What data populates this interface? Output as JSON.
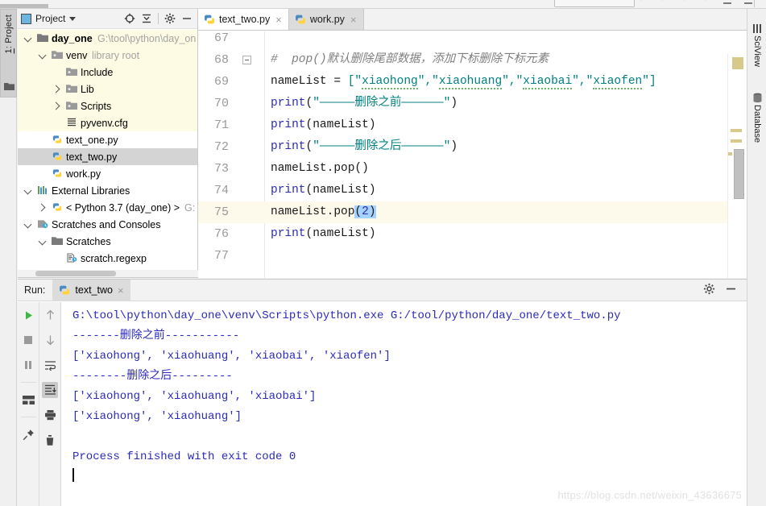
{
  "window": {
    "toolbar_hint": "partial-toolbar"
  },
  "left_rail": {
    "tab_label": "1: Project",
    "folder_icon": "folder-icon"
  },
  "project_panel": {
    "title": "Project",
    "icon": "project-window-icon",
    "caret": "chevron-down-icon",
    "buttons": [
      {
        "name": "locate-icon",
        "label": ""
      },
      {
        "name": "collapse-all-icon",
        "label": ""
      },
      {
        "name": "gear-icon",
        "label": ""
      },
      {
        "name": "hide-icon",
        "label": ""
      }
    ],
    "tree": [
      {
        "indent": 0,
        "arrow": "down",
        "icon": "folder-icon",
        "label": "day_one",
        "bold": true,
        "sub": "G:\\tool\\python\\day_on",
        "highlight": "yellow"
      },
      {
        "indent": 1,
        "arrow": "down",
        "icon": "module-icon",
        "label": "venv",
        "bold": false,
        "sub": "library root",
        "highlight": "yellow"
      },
      {
        "indent": 2,
        "arrow": "none",
        "icon": "module-icon",
        "label": "Include",
        "bold": false,
        "sub": "",
        "highlight": "yellow"
      },
      {
        "indent": 2,
        "arrow": "right",
        "icon": "module-icon",
        "label": "Lib",
        "bold": false,
        "sub": "",
        "highlight": "yellow"
      },
      {
        "indent": 2,
        "arrow": "right",
        "icon": "module-icon",
        "label": "Scripts",
        "bold": false,
        "sub": "",
        "highlight": "yellow"
      },
      {
        "indent": 2,
        "arrow": "none",
        "icon": "config-file-icon",
        "label": "pyvenv.cfg",
        "bold": false,
        "sub": "",
        "highlight": "yellow"
      },
      {
        "indent": 1,
        "arrow": "none",
        "icon": "python-file-icon",
        "label": "text_one.py",
        "bold": false,
        "sub": "",
        "highlight": "none"
      },
      {
        "indent": 1,
        "arrow": "none",
        "icon": "python-file-icon",
        "label": "text_two.py",
        "bold": false,
        "sub": "",
        "highlight": "gray"
      },
      {
        "indent": 1,
        "arrow": "none",
        "icon": "python-file-icon",
        "label": "work.py",
        "bold": false,
        "sub": "",
        "highlight": "none"
      },
      {
        "indent": 0,
        "arrow": "down",
        "icon": "libraries-icon",
        "label": "External Libraries",
        "bold": false,
        "sub": "",
        "highlight": "none"
      },
      {
        "indent": 1,
        "arrow": "right",
        "icon": "python-sdk-icon",
        "label": "< Python 3.7 (day_one) >",
        "bold": false,
        "sub": "G:",
        "highlight": "none"
      },
      {
        "indent": 0,
        "arrow": "down",
        "icon": "scratches-icon",
        "label": "Scratches and Consoles",
        "bold": false,
        "sub": "",
        "highlight": "none"
      },
      {
        "indent": 1,
        "arrow": "down",
        "icon": "folder-icon",
        "label": "Scratches",
        "bold": false,
        "sub": "",
        "highlight": "none"
      },
      {
        "indent": 2,
        "arrow": "none",
        "icon": "scratch-file-icon",
        "label": "scratch.regexp",
        "bold": false,
        "sub": "",
        "highlight": "none"
      }
    ]
  },
  "editor": {
    "tabs": [
      {
        "label": "text_two.py",
        "icon": "python-file-icon",
        "active": true,
        "close": "×"
      },
      {
        "label": "work.py",
        "icon": "python-file-icon",
        "active": false,
        "close": "×"
      }
    ],
    "first_line_number": 67,
    "current_line_number": 75,
    "lines": [
      {
        "num": 67,
        "text": "",
        "fold": false
      },
      {
        "num": 68,
        "text": "#  pop()默认删除尾部数据，添加下标删除下标元素",
        "fold": true
      },
      {
        "num": 69,
        "text": "nameList = [\"xiaohong\",\"xiaohuang\",\"xiaobai\",\"xiaofen\"]",
        "fold": false
      },
      {
        "num": 70,
        "text": "print(\"—————删除之前——————\")",
        "fold": false
      },
      {
        "num": 71,
        "text": "print(nameList)",
        "fold": false
      },
      {
        "num": 72,
        "text": "print(\"—————删除之后——————\")",
        "fold": false
      },
      {
        "num": 73,
        "text": "nameList.pop()",
        "fold": false
      },
      {
        "num": 74,
        "text": "print(nameList)",
        "fold": false
      },
      {
        "num": 75,
        "text": "nameList.pop(2)",
        "fold": false
      },
      {
        "num": 76,
        "text": "print(nameList)",
        "fold": false
      },
      {
        "num": 77,
        "text": "",
        "fold": false
      }
    ],
    "code_tokens": {
      "comment_68": "#  pop()默认删除尾部数据，添加下标删除下标元素",
      "var_name": "nameList",
      "strings_69": [
        "xiaohong",
        "xiaohuang",
        "xiaobai",
        "xiaofen"
      ],
      "banner_before": "—————删除之前——————",
      "banner_after": "—————删除之后——————",
      "print_fn": "print",
      "pop_fn": "pop",
      "pop_arg": "2"
    },
    "search_bubble_icon": "search-icon",
    "search_bubble_color": "#ef4444"
  },
  "right_rail": {
    "items": [
      {
        "label": "SciView",
        "icon": "grid-icon"
      },
      {
        "label": "Database",
        "icon": "database-icon"
      }
    ]
  },
  "run_panel": {
    "title": "Run:",
    "tab_label": "text_two",
    "tab_icon": "python-file-icon",
    "tab_close": "×",
    "header_buttons": [
      {
        "name": "gear-icon"
      },
      {
        "name": "hide-icon"
      }
    ],
    "toolbar_left": [
      {
        "name": "rerun-button",
        "glyph": "play"
      },
      {
        "name": "stop-button",
        "glyph": "stop"
      },
      {
        "name": "pause-button",
        "glyph": "pause"
      },
      {
        "name": "divider",
        "glyph": "divider"
      },
      {
        "name": "restore-layout-button",
        "glyph": "layout"
      },
      {
        "name": "divider",
        "glyph": "divider"
      },
      {
        "name": "pin-tab-button",
        "glyph": "pin"
      }
    ],
    "toolbar_right": [
      {
        "name": "up-button",
        "glyph": "up"
      },
      {
        "name": "down-button",
        "glyph": "down"
      },
      {
        "name": "soft-wrap-button",
        "glyph": "wrap"
      },
      {
        "name": "scroll-to-end-button",
        "glyph": "scroll-end",
        "active": true
      },
      {
        "name": "print-button",
        "glyph": "print"
      },
      {
        "name": "clear-all-button",
        "glyph": "trash"
      }
    ],
    "output": [
      {
        "text": "G:\\tool\\python\\day_one\\venv\\Scripts\\python.exe G:/tool/python/day_one/text_two.py",
        "style": "cmd"
      },
      {
        "text": "-------删除之前-----------",
        "style": "cmd"
      },
      {
        "text": "['xiaohong', 'xiaohuang', 'xiaobai', 'xiaofen']",
        "style": "cmd"
      },
      {
        "text": "--------删除之后---------",
        "style": "cmd"
      },
      {
        "text": "['xiaohong', 'xiaohuang', 'xiaobai']",
        "style": "cmd"
      },
      {
        "text": "['xiaohong', 'xiaohuang']",
        "style": "cmd"
      },
      {
        "text": "",
        "style": "cmd"
      },
      {
        "text": "Process finished with exit code 0",
        "style": "cmd"
      }
    ]
  },
  "watermark": {
    "text": "https://blog.csdn.net/weixin_43636675"
  }
}
